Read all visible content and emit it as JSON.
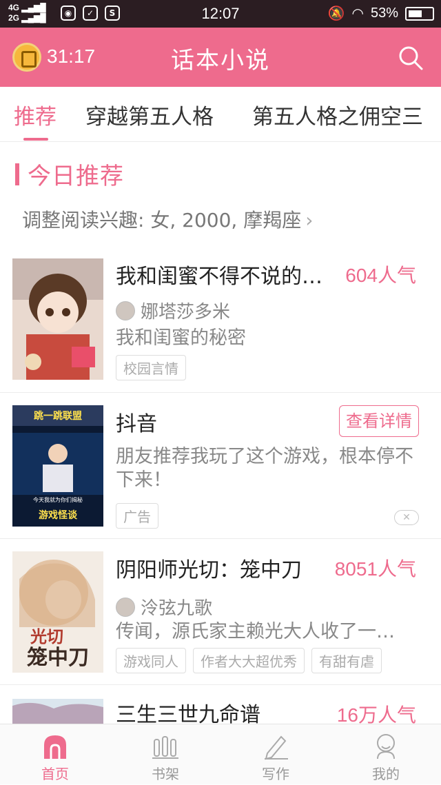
{
  "status_bar": {
    "network_top": "4G",
    "network_bottom": "2G",
    "icon_badge_3": "S",
    "time": "12:07",
    "battery": "53%"
  },
  "app_bar": {
    "timer": "31:17",
    "title": "话本小说",
    "brand_color": "#ee6b8d"
  },
  "tabs": [
    {
      "label": "推荐",
      "active": true
    },
    {
      "label": "穿越第五人格",
      "active": false
    },
    {
      "label": "第五人格之佣空三",
      "active": false
    }
  ],
  "section": {
    "title": "今日推荐",
    "interest_text": "调整阅读兴趣: 女, 2000, 摩羯座",
    "interest_chevron": "›"
  },
  "cards": [
    {
      "title": "我和闺蜜不得不说的…",
      "popularity": "604人气",
      "author": "娜塔莎多米",
      "desc": "我和闺蜜的秘密",
      "tags": [
        "校园言情"
      ]
    },
    {
      "title": "抖音",
      "detail_button": "查看详情",
      "desc": "朋友推荐我玩了这个游戏，根本停不下来！",
      "ad_label": "广告",
      "close_icon": "✕",
      "cover_top_text": "跳一跳联盟",
      "cover_bottom_text": "游戏怪谈",
      "cover_small_text": "今天我就为你们揭秘"
    },
    {
      "title": "阴阳师光切：笼中刀",
      "popularity": "8051人气",
      "author": "泠弦九歌",
      "desc": "传闻，源氏家主赖光大人收了一…",
      "tags": [
        "游戏同人",
        "作者大大超优秀",
        "有甜有虐"
      ],
      "cover_text_1": "光切",
      "cover_text_2": "笼中刀"
    },
    {
      "title": "三生三世九命谱",
      "popularity": "16万人气"
    }
  ],
  "bottom_nav": [
    {
      "label": "首页",
      "icon": "home-icon",
      "active": true
    },
    {
      "label": "书架",
      "icon": "bookshelf-icon",
      "active": false
    },
    {
      "label": "写作",
      "icon": "pencil-icon",
      "active": false
    },
    {
      "label": "我的",
      "icon": "profile-icon",
      "active": false
    }
  ]
}
